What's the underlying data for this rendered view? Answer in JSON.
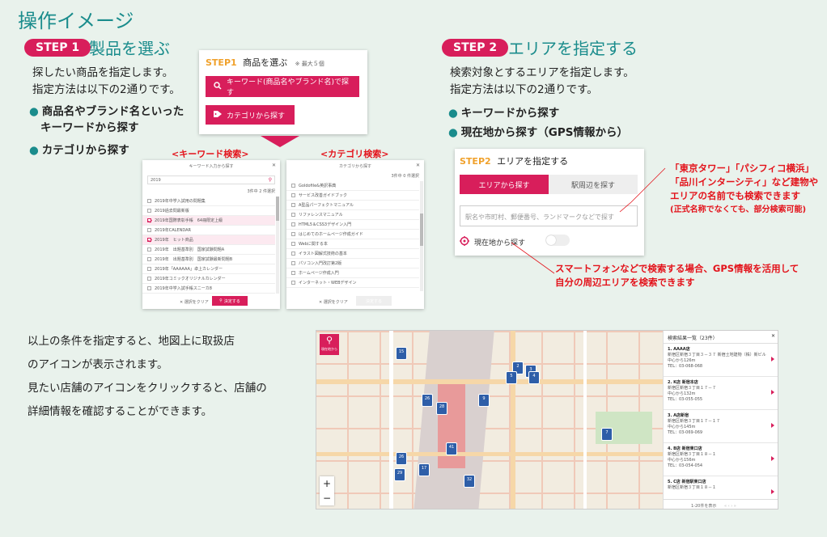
{
  "page_title": "操作イメージ",
  "step1": {
    "badge": "STEP 1",
    "heading": "製品を選ぶ",
    "desc_line1": "探したい商品を指定します。",
    "desc_line2": "指定方法は以下の2通りです。",
    "bullet1_line1": "商品名やブランド名といった",
    "bullet1_line2": "キーワードから探す",
    "bullet2": "カテゴリから探す",
    "card": {
      "label": "STEP1",
      "title": "商品を選ぶ",
      "note": "※ 最大５個",
      "keyword_button": "キーワード(商品名やブランド名)で探す",
      "category_button": "カテゴリから探す"
    },
    "keyword_caption": "<キーワード検索>",
    "category_caption": "<カテゴリ検索>",
    "keyword_modal": {
      "title": "キーワード入力から探す",
      "search_value": "2019",
      "count": "3件中 2 件選択",
      "rows": [
        "2019年中学入試用の問題集",
        "2019過去問最新版",
        "2019年国際表彰手帳　64冊限定上級",
        "2019年CALENDAR",
        "2019年　ヒット商品",
        "2019年　出題基準別　国家試験問題A",
        "2019年　出題基準別　国家試験最新問題B",
        "2019年「AAAAAA」卓上カレンダー",
        "2019年コミックオリジナルカレンダー",
        "2019年中学入試手帳スニーカ8"
      ],
      "checked": [
        false,
        false,
        true,
        false,
        true,
        false,
        false,
        false,
        false,
        false
      ],
      "clear_label": "✕ 選択をクリア",
      "decide_label": "決定する"
    },
    "category_modal": {
      "title": "カテゴリから探す",
      "count": "3件中 0 件選択",
      "rows": [
        "Goldofile&英訳事典",
        "サービス改善ガイドブック",
        "A型品パーフェクトマニュアル",
        "リファレンスマニュアル",
        "HTML5＆CSS3デザイン入門",
        "はじめてのホームページ作成ガイド",
        "Webに関する本",
        "イラスト図解式技術の基本",
        "パソコン入門改訂第2版",
        "ホームページ作成入門",
        "インターネット・WEBデザイン"
      ],
      "clear_label": "✕ 選択をクリア",
      "decide_label": "決定する"
    }
  },
  "step2": {
    "badge": "STEP 2",
    "heading": "エリアを指定する",
    "desc_line1": "検索対象とするエリアを指定します。",
    "desc_line2": "指定方法は以下の2通りです。",
    "bullet1": "キーワードから探す",
    "bullet2": "現在地から探す（GPS情報から）",
    "card": {
      "label": "STEP2",
      "title": "エリアを指定する",
      "tab_area": "エリアから探す",
      "tab_near": "駅周辺を探す",
      "placeholder": "駅名や市町村、郵便番号、ランドマークなどで探す",
      "gps_label": "現在地から探す"
    },
    "note1_line1": "「東京タワー」「パシフィコ横浜」",
    "note1_line2": "「品川インターシティ」など建物や",
    "note1_line3": "エリアの名前でも検索できます",
    "note1_line4": "(正式名称でなくても、部分検索可能)",
    "note2_line1": "スマートフォンなどで検索する場合、GPS情報を活用して",
    "note2_line2": "自分の周辺エリアを検索できます"
  },
  "result_text": {
    "line1": "以上の条件を指定すると、地図上に取扱店",
    "line2": "のアイコンが表示されます。",
    "line3": "見たい店舗のアイコンをクリックすると、店舗の",
    "line4": "詳細情報を確認することができます。"
  },
  "map": {
    "search_label": "現在地から",
    "zoom_in": "+",
    "zoom_out": "−",
    "pins": [
      "15",
      "2",
      "3",
      "4",
      "5",
      "26",
      "9",
      "28",
      "41",
      "17",
      "26",
      "32",
      "29",
      "7"
    ],
    "panel_title": "検索結果一覧（23件）",
    "results": [
      {
        "name": "1. AAAA店",
        "addr": "新宿区新宿３丁目３－３７ 新宿土地建物（株）新ビル",
        "dist": "中心から126m",
        "tel": "TEL：03-068-068"
      },
      {
        "name": "2. K店 新宿本店",
        "addr": "新宿区新宿３丁目１７－７",
        "dist": "中心から132m",
        "tel": "TEL：03-055-055"
      },
      {
        "name": "3. A店新宿",
        "addr": "新宿区新宿３丁目１７－１７",
        "dist": "中心から145m",
        "tel": "TEL：03-069-069"
      },
      {
        "name": "4. B店 新宿東口店",
        "addr": "新宿区新宿３丁目１８－１",
        "dist": "中心から156m",
        "tel": "TEL：03-054-054"
      },
      {
        "name": "5. C店 新宿駅東口店",
        "addr": "新宿区新宿３丁目１８－１",
        "dist": "",
        "tel": ""
      }
    ],
    "pagination": "1-20件を表示"
  },
  "colors": {
    "accent": "#d81e5b",
    "teal": "#1a8c8c",
    "note_red": "#e3131b",
    "step_label": "#f0a12b"
  }
}
